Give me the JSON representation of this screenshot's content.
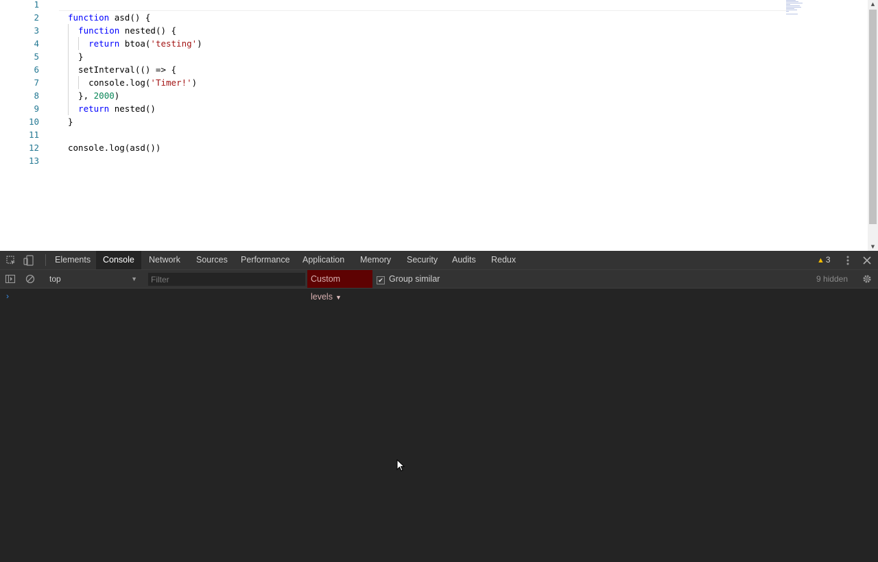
{
  "editor": {
    "line_numbers": [
      "1",
      "2",
      "3",
      "4",
      "5",
      "6",
      "7",
      "8",
      "9",
      "10",
      "11",
      "12",
      "13"
    ],
    "lines": [
      [],
      [
        {
          "t": "function",
          "c": "kw"
        },
        {
          "t": " asd() {",
          "c": ""
        }
      ],
      [
        {
          "t": "  function",
          "c": "kw"
        },
        {
          "t": " nested() {",
          "c": ""
        }
      ],
      [
        {
          "t": "    return",
          "c": "kw"
        },
        {
          "t": " btoa(",
          "c": ""
        },
        {
          "t": "'testing'",
          "c": "str"
        },
        {
          "t": ")",
          "c": ""
        }
      ],
      [
        {
          "t": "  }",
          "c": ""
        }
      ],
      [
        {
          "t": "  setInterval(() => {",
          "c": ""
        }
      ],
      [
        {
          "t": "    console.log(",
          "c": ""
        },
        {
          "t": "'Timer!'",
          "c": "str"
        },
        {
          "t": ")",
          "c": ""
        }
      ],
      [
        {
          "t": "  }, ",
          "c": ""
        },
        {
          "t": "2000",
          "c": "num"
        },
        {
          "t": ")",
          "c": ""
        }
      ],
      [
        {
          "t": "  return",
          "c": "kw"
        },
        {
          "t": " nested()",
          "c": ""
        }
      ],
      [
        {
          "t": "}",
          "c": ""
        }
      ],
      [],
      [
        {
          "t": "console.log(asd())",
          "c": ""
        }
      ],
      []
    ]
  },
  "devtools": {
    "tabs": [
      "Elements",
      "Console",
      "Network",
      "Sources",
      "Performance",
      "Application",
      "Memory",
      "Security",
      "Audits",
      "Redux"
    ],
    "active_tab": "Console",
    "warning_count": "3",
    "console": {
      "context": "top",
      "filter_placeholder": "Filter",
      "levels_label": "Custom levels",
      "group_similar_label": "Group similar",
      "group_similar_checked": true,
      "hidden_label": "9 hidden",
      "prompt_symbol": "›"
    }
  },
  "colors": {
    "keyword": "#0000ff",
    "string": "#a31515",
    "number": "#098658",
    "line_number": "#237893",
    "devtools_bg": "#242424",
    "levels_bg": "#5e0202"
  }
}
